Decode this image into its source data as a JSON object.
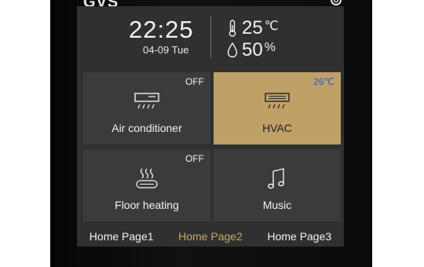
{
  "device": {
    "logo": "GVS"
  },
  "status": {
    "time": "22:25",
    "date": "04-09 Tue",
    "temperature": "25",
    "temperature_unit": "℃",
    "humidity": "50",
    "humidity_unit": "%"
  },
  "tiles": [
    {
      "label": "Air conditioner",
      "status": "OFF",
      "icon": "air-conditioner-icon",
      "active": false
    },
    {
      "label": "HVAC",
      "status": "26℃",
      "icon": "hvac-icon",
      "active": true
    },
    {
      "label": "Floor heating",
      "status": "OFF",
      "icon": "floor-heating-icon",
      "active": false
    },
    {
      "label": "Music",
      "status": "",
      "icon": "music-note-icon",
      "active": false
    }
  ],
  "pages": [
    {
      "label": "Home Page1",
      "active": false
    },
    {
      "label": "Home Page2",
      "active": true
    },
    {
      "label": "Home Page3",
      "active": false
    }
  ],
  "colors": {
    "active_tile": "#bfa067",
    "active_page": "#c9a866",
    "setpoint_text": "#2f56c8",
    "screen_bg": "#303030",
    "tile_bg": "#3b3b3b"
  }
}
